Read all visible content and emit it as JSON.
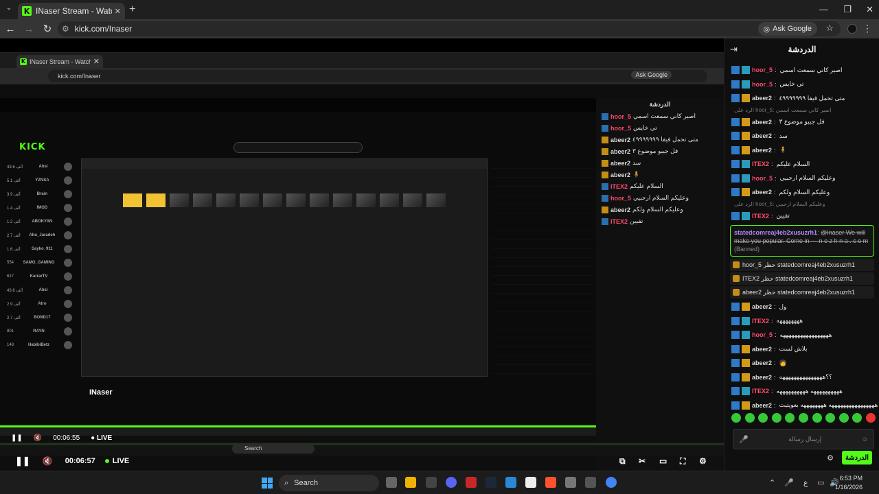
{
  "browser": {
    "tab_title": "INaser Stream - Watch Live on K",
    "url": "kick.com/Inaser",
    "ask_google": "Ask Google"
  },
  "nested": {
    "tab_title": "INaser Stream - Watch Live on",
    "url": "kick.com/Inaser",
    "ask_google": "Ask Google",
    "chat_title": "الدردشة",
    "deep_logo": "KICK",
    "deep_streamer": "INaser",
    "time": "00:06:55",
    "live": "LIVE",
    "sidebar": [
      {
        "name": "Absi",
        "count": "43.6 ألف"
      },
      {
        "name": "YZNSA",
        "count": "5.1 ألف"
      },
      {
        "name": "Brain",
        "count": "3.9 ألف"
      },
      {
        "name": "IMOD",
        "count": "1.4 ألف"
      },
      {
        "name": "ABOKYAN",
        "count": "1.2 ألف"
      },
      {
        "name": "Abu_Jaradeh",
        "count": "2.7 ألف"
      },
      {
        "name": "Sayko_911",
        "count": "1.6 ألف"
      },
      {
        "name": "SAMO_GAMING",
        "count": "554"
      },
      {
        "name": "KarrarTV",
        "count": "617"
      },
      {
        "name": "Absi",
        "count": "43.6 ألف"
      },
      {
        "name": "Atro",
        "count": "2.9 ألف"
      },
      {
        "name": "BOND17",
        "count": "2.7 ألف"
      },
      {
        "name": "RAYN",
        "count": "801"
      },
      {
        "name": "HabibiBetz",
        "count": "148"
      }
    ]
  },
  "player": {
    "time": "00:06:57",
    "live": "LIVE",
    "strip_search": "Search"
  },
  "chat": {
    "title": "الدردشة",
    "messages": [
      {
        "user": "hoor_5",
        "text": "اصير كاني سمعت اسمي",
        "color": "red"
      },
      {
        "user": "hoor_5",
        "text": "تي خايس",
        "color": "red"
      },
      {
        "user": "abeer2",
        "text": "متى تحمل فيفا ٤٩٩٩٩٩٩٩",
        "color": "green"
      }
    ],
    "reply_1": "الرد على hoor_5: اصير كاني سمعت اسمي",
    "messages2": [
      {
        "user": "abeer2",
        "text": "فل جيبو موضوع ٣",
        "color": "green"
      },
      {
        "user": "abeer2",
        "text": "سد",
        "color": "green"
      },
      {
        "user": "abeer2",
        "text": "🧍",
        "color": "green"
      },
      {
        "user": "ITEX2",
        "text": "السلام عليكم",
        "color": "red"
      },
      {
        "user": "hoor_5",
        "text": "وعليكم السلام ارحبيي",
        "color": "red"
      },
      {
        "user": "abeer2",
        "text": "وعليكم السلام ولكم",
        "color": "green"
      }
    ],
    "reply_2": "الرد على hoor_5: وعليكم السلام ارحبيي",
    "messages3": [
      {
        "user": "ITEX2",
        "text": "تقيين",
        "color": "red"
      }
    ],
    "banned": {
      "user": "statedcomreaj4eb2xusuzrh1",
      "text": "@Inaser We will make you popular. Come in — n e z h n a . c o m",
      "tag": "(Banned)"
    },
    "mod_rows": [
      "hoor_5 حظر statedcomreaj4eb2xusuzrh1",
      "ITEX2 حظر statedcomreaj4eb2xusuzrh1",
      "abeer2 حظر statedcomreaj4eb2xusuzrh1"
    ],
    "messages4": [
      {
        "user": "abeer2",
        "text": "ول",
        "color": "green"
      },
      {
        "user": "ITEX2",
        "text": "ههههههههه",
        "color": "red"
      },
      {
        "user": "hoor_5",
        "text": "هههههههههههههههههه",
        "color": "red"
      },
      {
        "user": "abeer2",
        "text": "بلاش لست",
        "color": "green"
      },
      {
        "user": "abeer2",
        "text": "🧑",
        "color": "green"
      },
      {
        "user": "abeer2",
        "text": "؟؟هههههههههههههههه",
        "color": "green"
      },
      {
        "user": "ITEX2",
        "text": "ههههههههههه ههههههههههه",
        "color": "red"
      },
      {
        "user": "abeer2",
        "text": "ههههههههههههههههه ههههههههه بعويتيت",
        "color": "green"
      }
    ],
    "input_placeholder": "إرسال رسالة",
    "send": "الدردشة"
  },
  "taskbar": {
    "search": "Search",
    "time": "6:53 PM",
    "date": "1/16/2026"
  },
  "colors": {
    "kick_green": "#53fc18",
    "chrome_dark": "#1f1f1f",
    "chat_bg": "#0f0f0f"
  }
}
